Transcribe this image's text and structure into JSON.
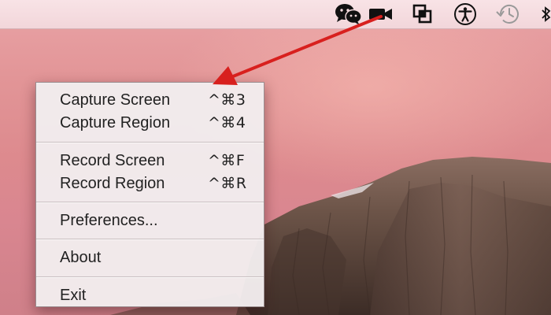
{
  "menubar": {
    "icons": [
      "wechat-icon",
      "video-camera-icon",
      "screen-capture-icon",
      "accessibility-icon",
      "time-machine-icon",
      "bluetooth-icon"
    ]
  },
  "menu": {
    "items": [
      {
        "label": "Capture Screen",
        "shortcut": "^⌘3"
      },
      {
        "label": "Capture Region",
        "shortcut": "^⌘4"
      },
      {
        "label": "Record Screen",
        "shortcut": "^⌘F"
      },
      {
        "label": "Record Region",
        "shortcut": "^⌘R"
      },
      {
        "label": "Preferences...",
        "shortcut": ""
      },
      {
        "label": "About",
        "shortcut": ""
      },
      {
        "label": "Exit",
        "shortcut": ""
      }
    ]
  },
  "annotation": {
    "arrow_color": "#d8201e"
  },
  "colors": {
    "menubar": "#f5dde0",
    "menu_background": "#f2eced",
    "menu_text": "#222222"
  }
}
